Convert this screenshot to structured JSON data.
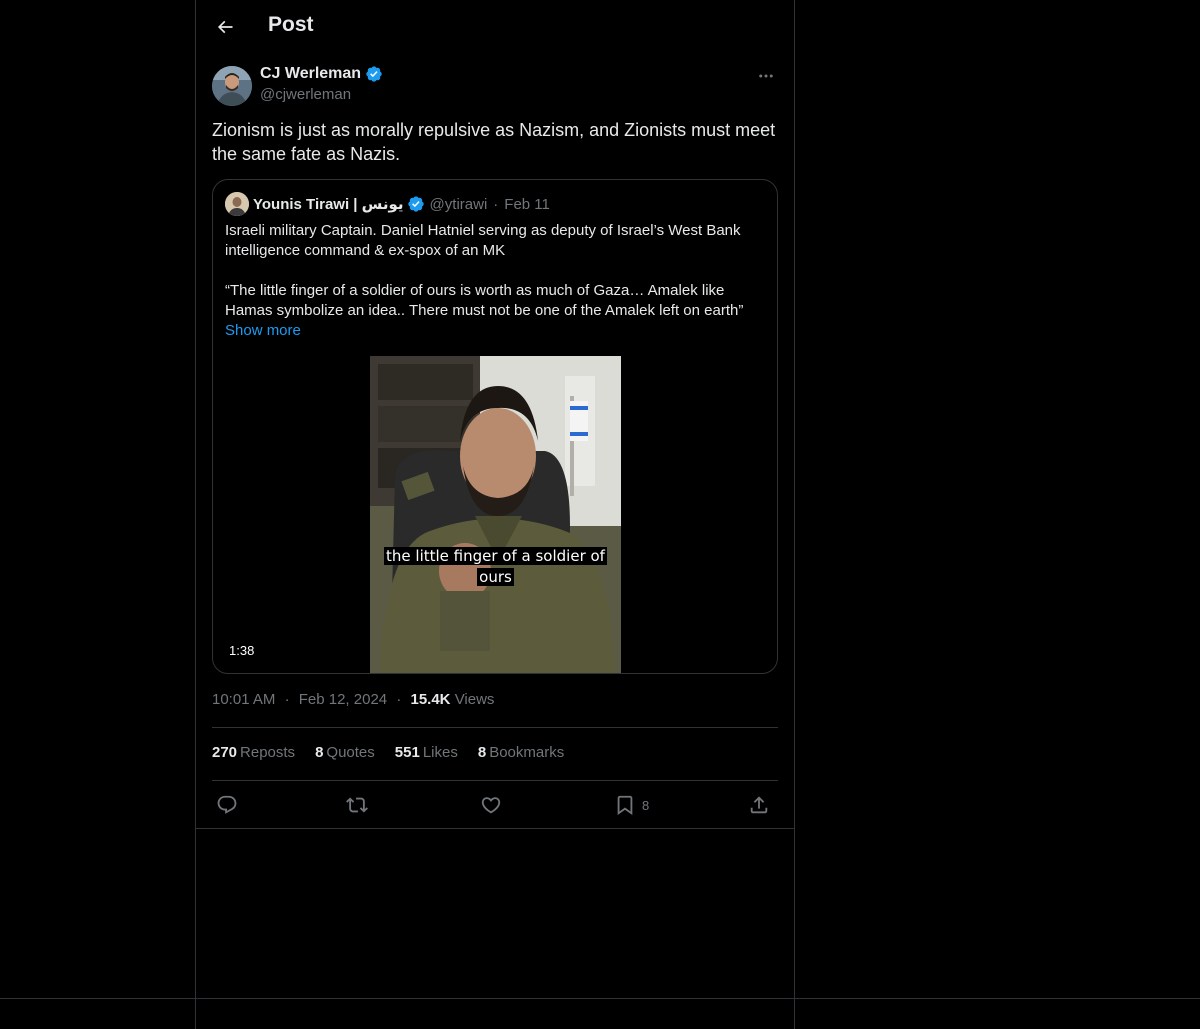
{
  "header": {
    "title": "Post"
  },
  "author": {
    "name": "CJ Werleman",
    "handle": "@cjwerleman"
  },
  "post": {
    "text": "Zionism is just as morally repulsive as Nazism, and Zionists must meet the same fate as Nazis."
  },
  "quote": {
    "name": "Younis Tirawi | يونس",
    "handle": "@ytirawi",
    "dot": "·",
    "date": "Feb 11",
    "paragraph1": "Israeli military Captain. Daniel Hatniel serving as deputy of Israel’s West Bank intelligence command & ex-spox of an MK",
    "paragraph2": "“The little finger of a soldier of ours is worth as much of Gaza… Amalek like Hamas symbolize an idea.. There must not be one of the Amalek left on earth”",
    "show_more": "Show more",
    "video": {
      "caption": "the little finger of a soldier of ours",
      "duration": "1:38"
    }
  },
  "meta": {
    "time": "10:01 AM",
    "dot": "·",
    "date": "Feb 12, 2024",
    "views_count": "15.4K",
    "views_label": "Views"
  },
  "stats": {
    "reposts_count": "270",
    "reposts_label": "Reposts",
    "quotes_count": "8",
    "quotes_label": "Quotes",
    "likes_count": "551",
    "likes_label": "Likes",
    "bookmarks_count": "8",
    "bookmarks_label": "Bookmarks"
  },
  "actions": {
    "bookmark_count": "8"
  },
  "icons": {
    "back": "arrow-left-icon",
    "more": "more-horizontal-icon",
    "verified": "verified-badge-icon",
    "reply": "reply-icon",
    "repost": "repost-icon",
    "like": "heart-icon",
    "bookmark": "bookmark-icon",
    "share": "share-icon"
  },
  "colors": {
    "background": "#000000",
    "text": "#e7e9ea",
    "secondary": "#71767b",
    "accent": "#1d9bf0",
    "border": "#2f3336"
  }
}
